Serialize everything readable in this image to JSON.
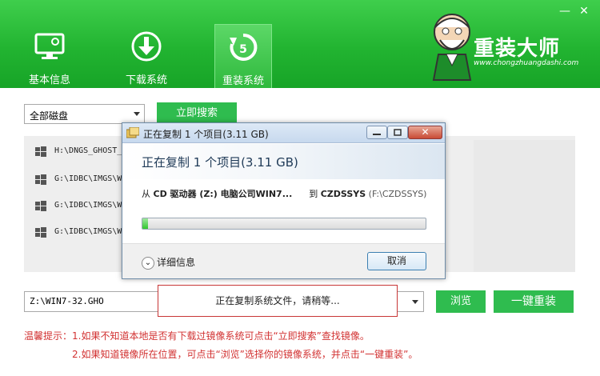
{
  "window": {
    "minimize_glyph": "—",
    "close_glyph": "✕"
  },
  "nav": {
    "tabs": [
      {
        "label": "基本信息",
        "icon": "monitor-icon"
      },
      {
        "label": "下载系统",
        "icon": "download-icon"
      },
      {
        "label": "重装系统",
        "icon": "restore-icon",
        "active": true
      }
    ]
  },
  "brand": {
    "title": "重装大师",
    "url": "www.chongzhuangdashi.com"
  },
  "disk_select": {
    "value": "全部磁盘"
  },
  "search_button": {
    "label": "立即搜索"
  },
  "image_list": [
    {
      "path": "H:\\DNGS_GHOST_W"
    },
    {
      "path": "G:\\IDBC\\IMGS\\W"
    },
    {
      "path": "G:\\IDBC\\IMGS\\W"
    },
    {
      "path": "G:\\IDBC\\IMGS\\W"
    }
  ],
  "path_field": {
    "value": "Z:\\WIN7-32.GHO"
  },
  "status_box": {
    "text": "正在复制系统文件，请稍等..."
  },
  "browse_button": {
    "label": "浏览"
  },
  "reinstall_button": {
    "label": "一键重装"
  },
  "tips": {
    "prefix": "温馨提示：",
    "line1": "1.如果不知道本地是否有下载过镜像系统可点击“立即搜索”查找镜像。",
    "line2": "2.如果知道镜像所在位置，可点击“浏览”选择你的镜像系统，并点击“一键重装”。"
  },
  "copy_dialog": {
    "title": "正在复制 1 个项目(3.11 GB)",
    "heading": "正在复制 1 个项目(3.11 GB)",
    "from_label": "从",
    "from_value": "CD 驱动器 (Z:) 电脑公司WIN7...",
    "to_label": "到",
    "to_value": "CZDSSYS",
    "to_path": "(F:\\CZDSSYS)",
    "progress": 0.02,
    "details_label": "详细信息",
    "cancel_label": "取消"
  },
  "colors": {
    "header_green": "#22b431",
    "button_green": "#2fbc4f",
    "tip_red": "#d23232",
    "status_border": "#c83636"
  }
}
